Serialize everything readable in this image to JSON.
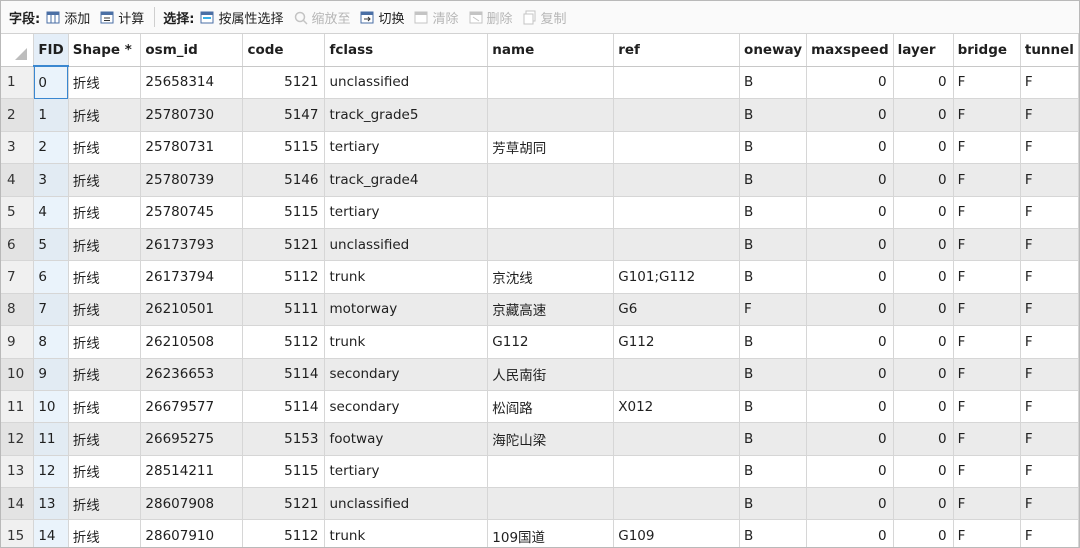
{
  "toolbar": {
    "field_label": "字段:",
    "add_label": "添加",
    "calculate_label": "计算",
    "select_label": "选择:",
    "select_by_attr_label": "按属性选择",
    "zoom_to_label": "缩放至",
    "switch_label": "切换",
    "clear_label": "清除",
    "delete_label": "删除",
    "copy_label": "复制"
  },
  "table": {
    "columns": [
      "FID",
      "Shape *",
      "osm_id",
      "code",
      "fclass",
      "name",
      "ref",
      "oneway",
      "maxspeed",
      "layer",
      "bridge",
      "tunnel"
    ],
    "rows": [
      {
        "n": "1",
        "fid": "0",
        "shape": "折线",
        "osm_id": "25658314",
        "code": "5121",
        "fclass": "unclassified",
        "name": "",
        "ref": "",
        "oneway": "B",
        "maxspeed": "0",
        "layer": "0",
        "bridge": "F",
        "tunnel": "F"
      },
      {
        "n": "2",
        "fid": "1",
        "shape": "折线",
        "osm_id": "25780730",
        "code": "5147",
        "fclass": "track_grade5",
        "name": "",
        "ref": "",
        "oneway": "B",
        "maxspeed": "0",
        "layer": "0",
        "bridge": "F",
        "tunnel": "F"
      },
      {
        "n": "3",
        "fid": "2",
        "shape": "折线",
        "osm_id": "25780731",
        "code": "5115",
        "fclass": "tertiary",
        "name": "芳草胡同",
        "ref": "",
        "oneway": "B",
        "maxspeed": "0",
        "layer": "0",
        "bridge": "F",
        "tunnel": "F"
      },
      {
        "n": "4",
        "fid": "3",
        "shape": "折线",
        "osm_id": "25780739",
        "code": "5146",
        "fclass": "track_grade4",
        "name": "",
        "ref": "",
        "oneway": "B",
        "maxspeed": "0",
        "layer": "0",
        "bridge": "F",
        "tunnel": "F"
      },
      {
        "n": "5",
        "fid": "4",
        "shape": "折线",
        "osm_id": "25780745",
        "code": "5115",
        "fclass": "tertiary",
        "name": "",
        "ref": "",
        "oneway": "B",
        "maxspeed": "0",
        "layer": "0",
        "bridge": "F",
        "tunnel": "F"
      },
      {
        "n": "6",
        "fid": "5",
        "shape": "折线",
        "osm_id": "26173793",
        "code": "5121",
        "fclass": "unclassified",
        "name": "",
        "ref": "",
        "oneway": "B",
        "maxspeed": "0",
        "layer": "0",
        "bridge": "F",
        "tunnel": "F"
      },
      {
        "n": "7",
        "fid": "6",
        "shape": "折线",
        "osm_id": "26173794",
        "code": "5112",
        "fclass": "trunk",
        "name": "京沈线",
        "ref": "G101;G112",
        "oneway": "B",
        "maxspeed": "0",
        "layer": "0",
        "bridge": "F",
        "tunnel": "F"
      },
      {
        "n": "8",
        "fid": "7",
        "shape": "折线",
        "osm_id": "26210501",
        "code": "5111",
        "fclass": "motorway",
        "name": "京藏高速",
        "ref": "G6",
        "oneway": "F",
        "maxspeed": "0",
        "layer": "0",
        "bridge": "F",
        "tunnel": "F"
      },
      {
        "n": "9",
        "fid": "8",
        "shape": "折线",
        "osm_id": "26210508",
        "code": "5112",
        "fclass": "trunk",
        "name": "G112",
        "ref": "G112",
        "oneway": "B",
        "maxspeed": "0",
        "layer": "0",
        "bridge": "F",
        "tunnel": "F"
      },
      {
        "n": "10",
        "fid": "9",
        "shape": "折线",
        "osm_id": "26236653",
        "code": "5114",
        "fclass": "secondary",
        "name": "人民南街",
        "ref": "",
        "oneway": "B",
        "maxspeed": "0",
        "layer": "0",
        "bridge": "F",
        "tunnel": "F"
      },
      {
        "n": "11",
        "fid": "10",
        "shape": "折线",
        "osm_id": "26679577",
        "code": "5114",
        "fclass": "secondary",
        "name": "松阎路",
        "ref": "X012",
        "oneway": "B",
        "maxspeed": "0",
        "layer": "0",
        "bridge": "F",
        "tunnel": "F"
      },
      {
        "n": "12",
        "fid": "11",
        "shape": "折线",
        "osm_id": "26695275",
        "code": "5153",
        "fclass": "footway",
        "name": "海陀山梁",
        "ref": "",
        "oneway": "B",
        "maxspeed": "0",
        "layer": "0",
        "bridge": "F",
        "tunnel": "F"
      },
      {
        "n": "13",
        "fid": "12",
        "shape": "折线",
        "osm_id": "28514211",
        "code": "5115",
        "fclass": "tertiary",
        "name": "",
        "ref": "",
        "oneway": "B",
        "maxspeed": "0",
        "layer": "0",
        "bridge": "F",
        "tunnel": "F"
      },
      {
        "n": "14",
        "fid": "13",
        "shape": "折线",
        "osm_id": "28607908",
        "code": "5121",
        "fclass": "unclassified",
        "name": "",
        "ref": "",
        "oneway": "B",
        "maxspeed": "0",
        "layer": "0",
        "bridge": "F",
        "tunnel": "F"
      },
      {
        "n": "15",
        "fid": "14",
        "shape": "折线",
        "osm_id": "28607910",
        "code": "5112",
        "fclass": "trunk",
        "name": "109国道",
        "ref": "G109",
        "oneway": "B",
        "maxspeed": "0",
        "layer": "0",
        "bridge": "F",
        "tunnel": "F"
      }
    ]
  },
  "colors": {
    "accent": "#3a87d0",
    "alt_row": "#ebebeb",
    "disabled_text": "#b6b6b6"
  }
}
